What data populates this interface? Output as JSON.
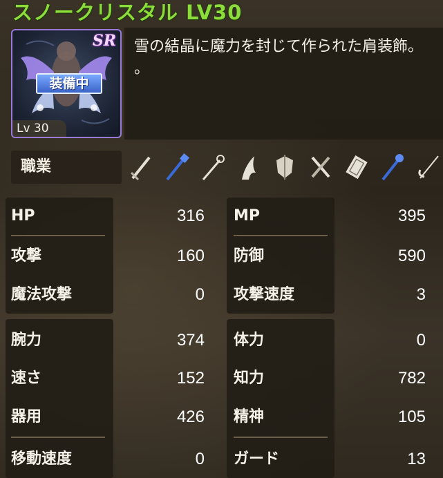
{
  "item": {
    "name": "スノークリスタル LV30",
    "rarity": "SR",
    "equipped_label": "装備中",
    "level_label": "Lv 30",
    "description": "雪の結晶に魔力を封じて作られた肩装飾。\n。"
  },
  "job": {
    "label": "職業",
    "icons": [
      "sword-icon",
      "staff-icon",
      "wand-icon",
      "claw-icon",
      "shield-icon",
      "dual-blade-icon",
      "card-icon",
      "scepter-icon",
      "rapier-icon"
    ],
    "icon_colors": {
      "active": "#3a6ad8",
      "inactive": "#d8d2c4"
    }
  },
  "stats": {
    "group1": {
      "left": [
        {
          "label": "HP",
          "value": "316"
        },
        {
          "label": "攻撃",
          "value": "160"
        },
        {
          "label": "魔法攻撃",
          "value": "0"
        }
      ],
      "right": [
        {
          "label": "MP",
          "value": "395"
        },
        {
          "label": "防御",
          "value": "590"
        },
        {
          "label": "攻撃速度",
          "value": "3"
        }
      ]
    },
    "group2": {
      "left": [
        {
          "label": "腕力",
          "value": "374"
        },
        {
          "label": "速さ",
          "value": "152"
        },
        {
          "label": "器用",
          "value": "426"
        },
        {
          "label": "移動速度",
          "value": "0"
        }
      ],
      "right": [
        {
          "label": "体力",
          "value": "0"
        },
        {
          "label": "知力",
          "value": "782"
        },
        {
          "label": "精神",
          "value": "105"
        },
        {
          "label": "ガード",
          "value": "13"
        }
      ]
    }
  },
  "colors": {
    "title": "#8cdc3c",
    "rarity_border": "#9a7ad8",
    "equipped_badge": "#4a78e0"
  }
}
